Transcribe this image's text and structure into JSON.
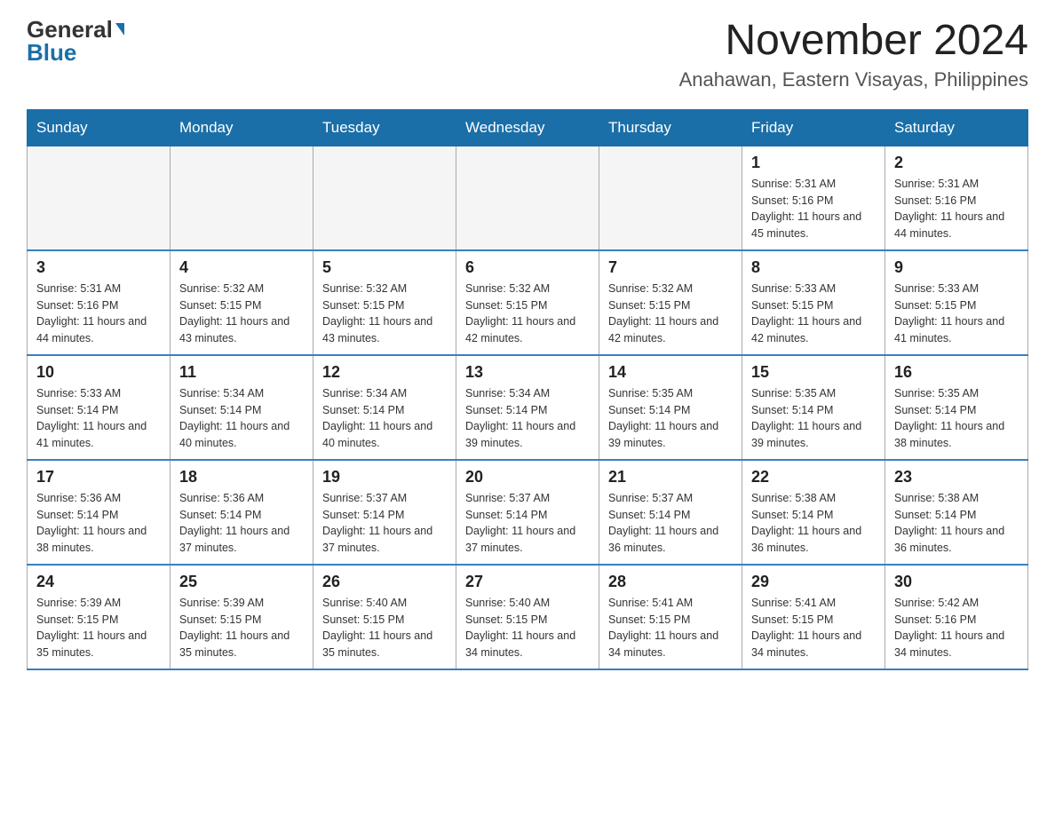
{
  "header": {
    "logo": {
      "general": "General",
      "blue": "Blue"
    },
    "title": "November 2024",
    "location": "Anahawan, Eastern Visayas, Philippines"
  },
  "calendar": {
    "days_of_week": [
      "Sunday",
      "Monday",
      "Tuesday",
      "Wednesday",
      "Thursday",
      "Friday",
      "Saturday"
    ],
    "weeks": [
      [
        {
          "day": "",
          "info": ""
        },
        {
          "day": "",
          "info": ""
        },
        {
          "day": "",
          "info": ""
        },
        {
          "day": "",
          "info": ""
        },
        {
          "day": "",
          "info": ""
        },
        {
          "day": "1",
          "info": "Sunrise: 5:31 AM\nSunset: 5:16 PM\nDaylight: 11 hours and 45 minutes."
        },
        {
          "day": "2",
          "info": "Sunrise: 5:31 AM\nSunset: 5:16 PM\nDaylight: 11 hours and 44 minutes."
        }
      ],
      [
        {
          "day": "3",
          "info": "Sunrise: 5:31 AM\nSunset: 5:16 PM\nDaylight: 11 hours and 44 minutes."
        },
        {
          "day": "4",
          "info": "Sunrise: 5:32 AM\nSunset: 5:15 PM\nDaylight: 11 hours and 43 minutes."
        },
        {
          "day": "5",
          "info": "Sunrise: 5:32 AM\nSunset: 5:15 PM\nDaylight: 11 hours and 43 minutes."
        },
        {
          "day": "6",
          "info": "Sunrise: 5:32 AM\nSunset: 5:15 PM\nDaylight: 11 hours and 42 minutes."
        },
        {
          "day": "7",
          "info": "Sunrise: 5:32 AM\nSunset: 5:15 PM\nDaylight: 11 hours and 42 minutes."
        },
        {
          "day": "8",
          "info": "Sunrise: 5:33 AM\nSunset: 5:15 PM\nDaylight: 11 hours and 42 minutes."
        },
        {
          "day": "9",
          "info": "Sunrise: 5:33 AM\nSunset: 5:15 PM\nDaylight: 11 hours and 41 minutes."
        }
      ],
      [
        {
          "day": "10",
          "info": "Sunrise: 5:33 AM\nSunset: 5:14 PM\nDaylight: 11 hours and 41 minutes."
        },
        {
          "day": "11",
          "info": "Sunrise: 5:34 AM\nSunset: 5:14 PM\nDaylight: 11 hours and 40 minutes."
        },
        {
          "day": "12",
          "info": "Sunrise: 5:34 AM\nSunset: 5:14 PM\nDaylight: 11 hours and 40 minutes."
        },
        {
          "day": "13",
          "info": "Sunrise: 5:34 AM\nSunset: 5:14 PM\nDaylight: 11 hours and 39 minutes."
        },
        {
          "day": "14",
          "info": "Sunrise: 5:35 AM\nSunset: 5:14 PM\nDaylight: 11 hours and 39 minutes."
        },
        {
          "day": "15",
          "info": "Sunrise: 5:35 AM\nSunset: 5:14 PM\nDaylight: 11 hours and 39 minutes."
        },
        {
          "day": "16",
          "info": "Sunrise: 5:35 AM\nSunset: 5:14 PM\nDaylight: 11 hours and 38 minutes."
        }
      ],
      [
        {
          "day": "17",
          "info": "Sunrise: 5:36 AM\nSunset: 5:14 PM\nDaylight: 11 hours and 38 minutes."
        },
        {
          "day": "18",
          "info": "Sunrise: 5:36 AM\nSunset: 5:14 PM\nDaylight: 11 hours and 37 minutes."
        },
        {
          "day": "19",
          "info": "Sunrise: 5:37 AM\nSunset: 5:14 PM\nDaylight: 11 hours and 37 minutes."
        },
        {
          "day": "20",
          "info": "Sunrise: 5:37 AM\nSunset: 5:14 PM\nDaylight: 11 hours and 37 minutes."
        },
        {
          "day": "21",
          "info": "Sunrise: 5:37 AM\nSunset: 5:14 PM\nDaylight: 11 hours and 36 minutes."
        },
        {
          "day": "22",
          "info": "Sunrise: 5:38 AM\nSunset: 5:14 PM\nDaylight: 11 hours and 36 minutes."
        },
        {
          "day": "23",
          "info": "Sunrise: 5:38 AM\nSunset: 5:14 PM\nDaylight: 11 hours and 36 minutes."
        }
      ],
      [
        {
          "day": "24",
          "info": "Sunrise: 5:39 AM\nSunset: 5:15 PM\nDaylight: 11 hours and 35 minutes."
        },
        {
          "day": "25",
          "info": "Sunrise: 5:39 AM\nSunset: 5:15 PM\nDaylight: 11 hours and 35 minutes."
        },
        {
          "day": "26",
          "info": "Sunrise: 5:40 AM\nSunset: 5:15 PM\nDaylight: 11 hours and 35 minutes."
        },
        {
          "day": "27",
          "info": "Sunrise: 5:40 AM\nSunset: 5:15 PM\nDaylight: 11 hours and 34 minutes."
        },
        {
          "day": "28",
          "info": "Sunrise: 5:41 AM\nSunset: 5:15 PM\nDaylight: 11 hours and 34 minutes."
        },
        {
          "day": "29",
          "info": "Sunrise: 5:41 AM\nSunset: 5:15 PM\nDaylight: 11 hours and 34 minutes."
        },
        {
          "day": "30",
          "info": "Sunrise: 5:42 AM\nSunset: 5:16 PM\nDaylight: 11 hours and 34 minutes."
        }
      ]
    ]
  }
}
